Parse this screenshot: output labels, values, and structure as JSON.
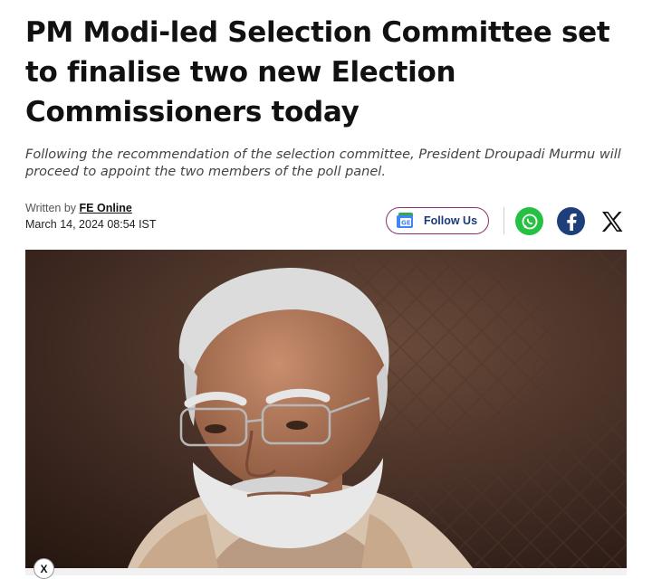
{
  "article": {
    "headline": "PM Modi-led Selection Committee set to finalise two new Election Commissioners today",
    "summary": "Following the recommendation of the selection committee, President Droupadi Murmu will proceed to appoint the two members of the poll panel.",
    "byline_label": "Written by",
    "author": "FE Online",
    "date": "March 14, 2024 08:54 IST"
  },
  "share": {
    "follow_label": "Follow Us",
    "follow_icon": "google-news-icon",
    "buttons": [
      "whatsapp-icon",
      "facebook-icon",
      "x-icon"
    ]
  },
  "ad": {
    "close_label": "X"
  },
  "colors": {
    "follow_border": "#8b2f6f",
    "follow_text": "#1a3a7a",
    "whatsapp": "#25c142",
    "facebook": "#1f3f7a"
  }
}
